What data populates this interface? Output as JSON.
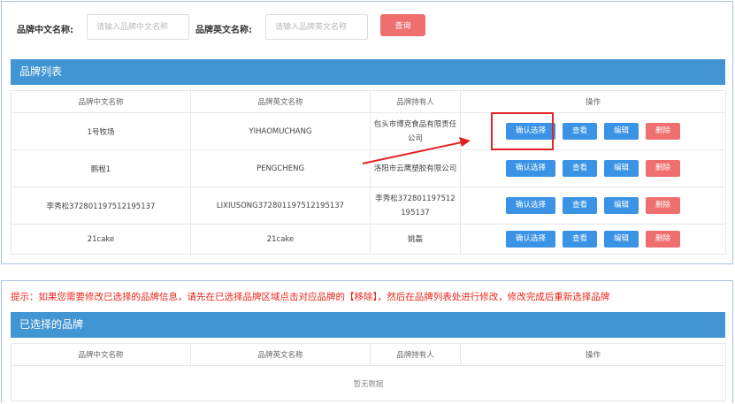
{
  "search": {
    "cn_label": "品牌中文名称:",
    "cn_placeholder": "请输入品牌中文名称",
    "en_label": "品牌英文名称:",
    "en_placeholder": "请输入品牌英文名称",
    "query_label": "查询"
  },
  "brand_list": {
    "title": "品牌列表",
    "columns": [
      "品牌中文名称",
      "品牌英文名称",
      "品牌持有人",
      "操作"
    ],
    "rows": [
      {
        "cn": "1号牧场",
        "en": "YIHAOMUCHANG",
        "owner": "包头市博克食品有限责任公司"
      },
      {
        "cn": "鹏程1",
        "en": "PENGCHENG",
        "owner": "洛阳市云鹰塑胶有限公司"
      },
      {
        "cn": "李秀松372801197512195137",
        "en": "LIXIUSONG372801197512195137",
        "owner": "李秀松372801197512195137"
      },
      {
        "cn": "21cake",
        "en": "21cake",
        "owner": "姚磊"
      }
    ],
    "actions": {
      "confirm": "确认选择",
      "view": "查看",
      "edit": "编辑",
      "delete": "删除"
    }
  },
  "hint": "提示：如果您需要修改已选择的品牌信息，请先在已选择品牌区域点击对应品牌的【移除】，然后在品牌列表处进行修改，修改完成后重新选择品牌",
  "selected": {
    "title": "已选择的品牌",
    "columns": [
      "品牌中文名称",
      "品牌英文名称",
      "品牌持有人",
      "操作"
    ],
    "empty_text": "暂无数据"
  },
  "colors": {
    "header_blue": "#4295d3",
    "button_blue": "#3a93e4",
    "button_red": "#ef6f6f",
    "annotation_red": "#e52222"
  }
}
